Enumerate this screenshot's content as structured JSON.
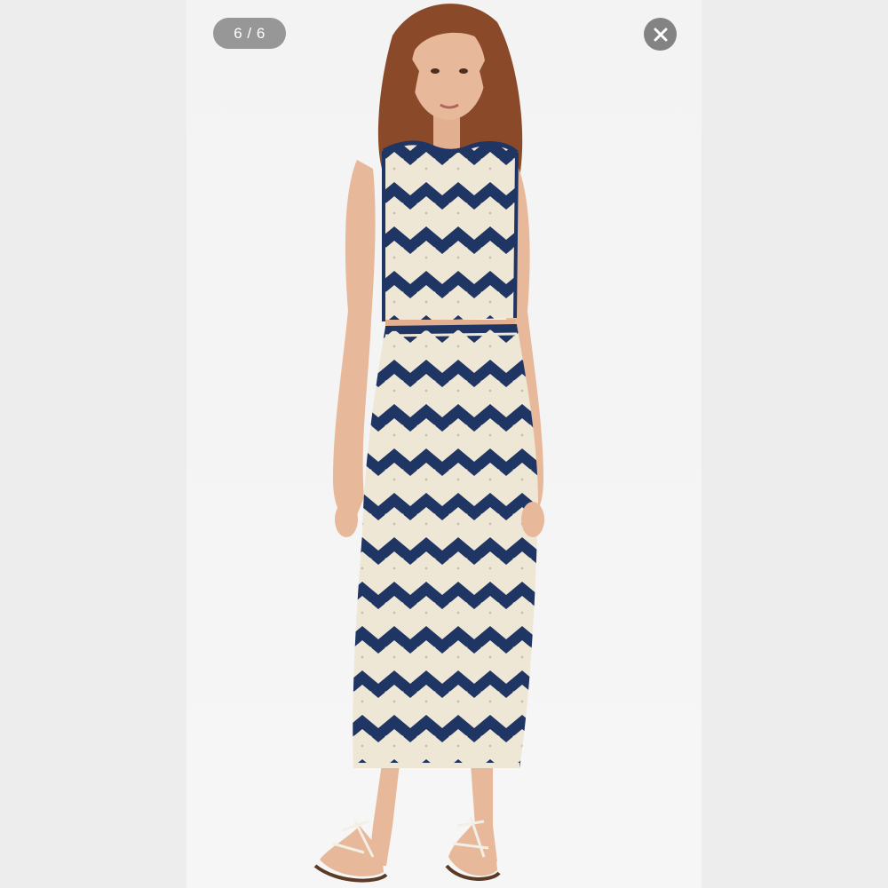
{
  "viewer": {
    "counter_text": "6 / 6",
    "close_icon": "close-icon",
    "photo_description_colors": {
      "navy": "#1f3563",
      "cream": "#efe7d6",
      "skin": "#e7b99a",
      "hair": "#8a4a2a",
      "backdrop": "#f4f4f4",
      "side_panel": "#ededed"
    }
  }
}
